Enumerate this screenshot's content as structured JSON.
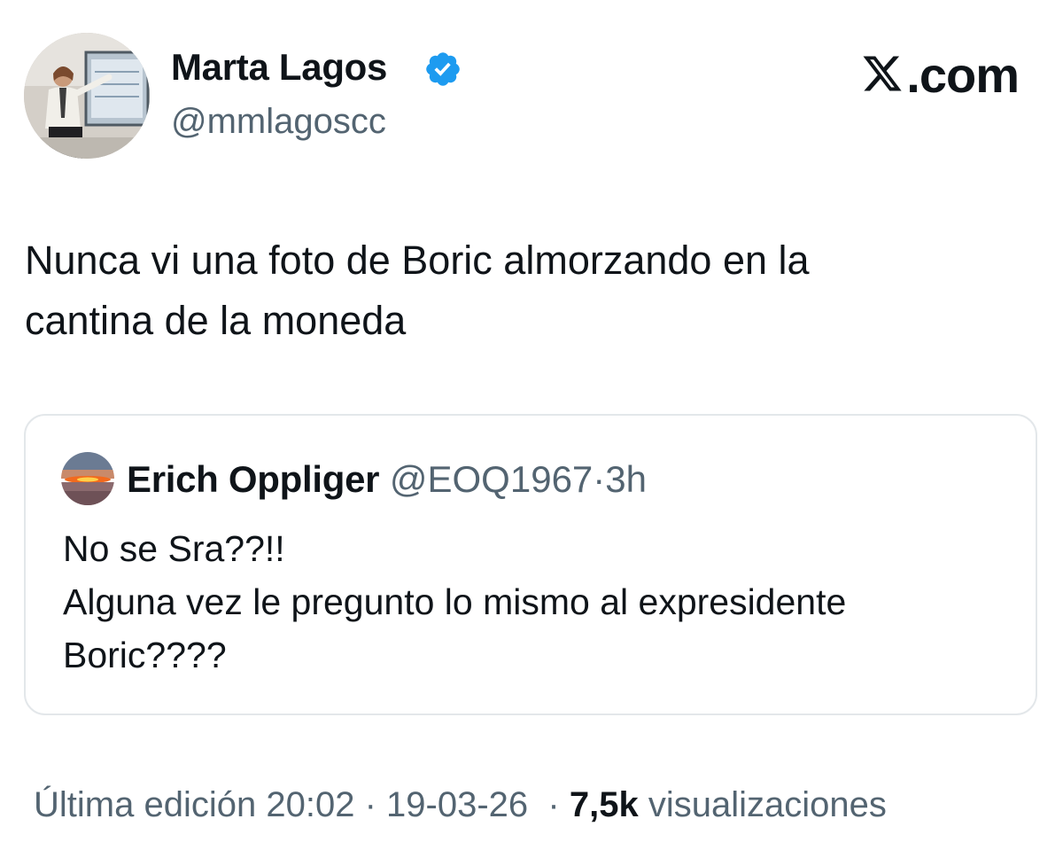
{
  "author": {
    "name": "Marta Lagos",
    "handle": "@mmlagoscc",
    "verified_color": "#1d9bf0"
  },
  "brand": {
    "label": ".com"
  },
  "tweet": {
    "line1": "Nunca vi una foto de Boric almorzando en la",
    "line2": "cantina de la moneda"
  },
  "quoted": {
    "name": "Erich Oppliger",
    "handle": "@EOQ1967",
    "separator": "·",
    "time": "3h",
    "line1": "No se Sra??!!",
    "line2": "Alguna vez le pregunto lo mismo al expresidente",
    "line3": "Boric????"
  },
  "meta": {
    "edited_label": "Última edición",
    "time": "20:02",
    "dot1": "·",
    "date": "19-03-26",
    "dot2": "·",
    "views_count": "7,5k",
    "views_label": "visualizaciones"
  },
  "icons": {
    "author_avatar": "avatar-photo",
    "verified": "verified-badge-icon",
    "brand_logo": "x-logo-icon",
    "quote_avatar": "sunset-avatar"
  }
}
